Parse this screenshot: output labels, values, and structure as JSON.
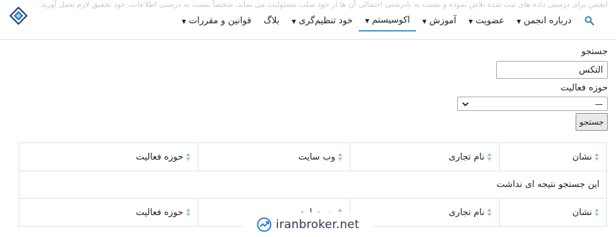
{
  "notice": "انجمن برای درستی داده های ثبت شده تلاش نموده و نسبت به نادرستی احتمالی آن ها از خود سلب مسئولیت می نماید. شخصاً نسبت به درستی اطلاعات، خود تحقیق لازم بعمل آورید.",
  "nav": {
    "items": [
      {
        "label": "درباره انجمن",
        "has_caret": true
      },
      {
        "label": "عضویت",
        "has_caret": true
      },
      {
        "label": "آموزش",
        "has_caret": true
      },
      {
        "label": "اکوسیستم",
        "has_caret": true,
        "active": true
      },
      {
        "label": "خود تنظیم‌گری",
        "has_caret": true
      },
      {
        "label": "بلاگ",
        "has_caret": false
      },
      {
        "label": "قوانین و مقررات",
        "has_caret": true
      }
    ],
    "accent": "#3a9bd5"
  },
  "search": {
    "label": "جستجو",
    "value": "التکس",
    "field_label": "حوزه فعالیت",
    "select_value": "—",
    "button": "جستجو"
  },
  "table": {
    "columns": [
      "نشان",
      "نام تجاری",
      "وب سایت",
      "حوزه فعالیت"
    ],
    "empty_message": "این جستجو نتیجه ای نداشت"
  },
  "watermark": "iranbroker.net"
}
